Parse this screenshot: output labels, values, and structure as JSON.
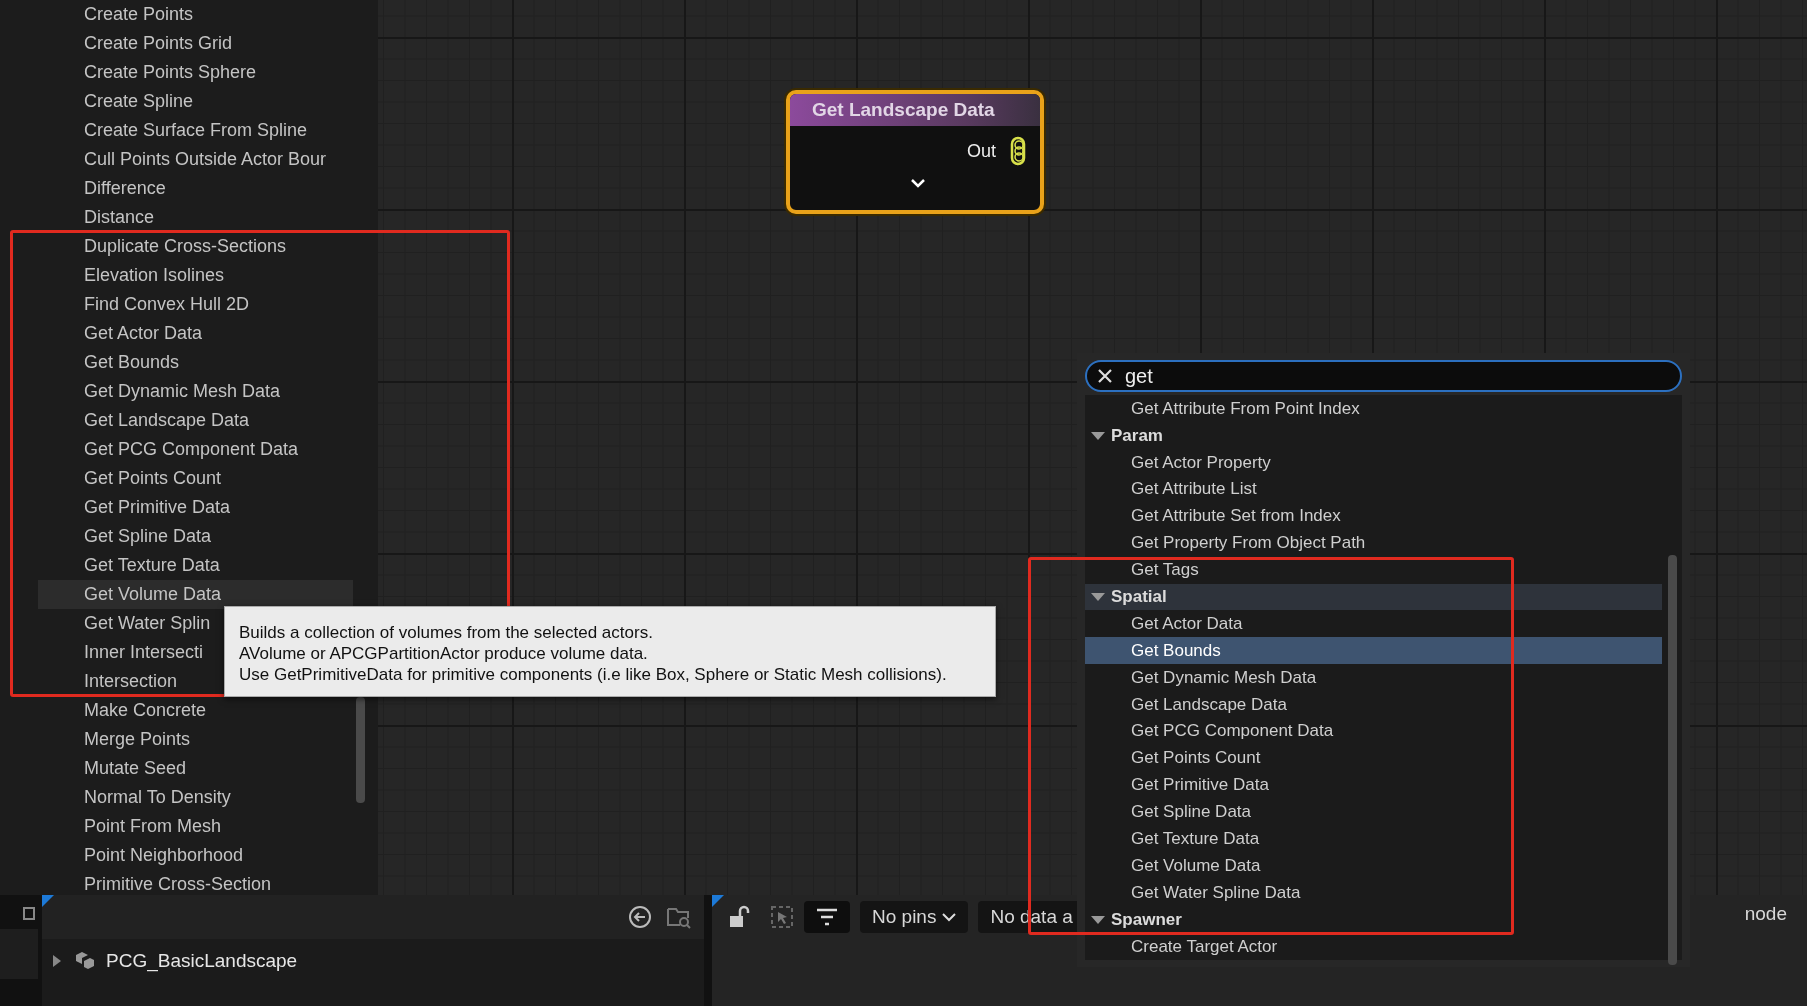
{
  "node_list": {
    "items": [
      {
        "label": "Create Points",
        "selected": false
      },
      {
        "label": "Create Points Grid",
        "selected": false
      },
      {
        "label": "Create Points Sphere",
        "selected": false
      },
      {
        "label": "Create Spline",
        "selected": false
      },
      {
        "label": "Create Surface From Spline",
        "selected": false
      },
      {
        "label": "Cull Points Outside Actor Bour",
        "selected": false
      },
      {
        "label": "Difference",
        "selected": false
      },
      {
        "label": "Distance",
        "selected": false
      },
      {
        "label": "Duplicate Cross-Sections",
        "selected": false
      },
      {
        "label": "Elevation Isolines",
        "selected": false
      },
      {
        "label": "Find Convex Hull 2D",
        "selected": false
      },
      {
        "label": "Get Actor Data",
        "selected": false
      },
      {
        "label": "Get Bounds",
        "selected": false
      },
      {
        "label": "Get Dynamic Mesh Data",
        "selected": false
      },
      {
        "label": "Get Landscape Data",
        "selected": false
      },
      {
        "label": "Get PCG Component Data",
        "selected": false
      },
      {
        "label": "Get Points Count",
        "selected": false
      },
      {
        "label": "Get Primitive Data",
        "selected": false
      },
      {
        "label": "Get Spline Data",
        "selected": false
      },
      {
        "label": "Get Texture Data",
        "selected": false
      },
      {
        "label": "Get Volume Data",
        "selected": true
      },
      {
        "label": "Get Water Splin",
        "selected": false
      },
      {
        "label": "Inner Intersecti",
        "selected": false
      },
      {
        "label": "Intersection",
        "selected": false
      },
      {
        "label": "Make Concrete",
        "selected": false
      },
      {
        "label": "Merge Points",
        "selected": false
      },
      {
        "label": "Mutate Seed",
        "selected": false
      },
      {
        "label": "Normal To Density",
        "selected": false
      },
      {
        "label": "Point From Mesh",
        "selected": false
      },
      {
        "label": "Point Neighborhood",
        "selected": false
      },
      {
        "label": "Primitive Cross-Section",
        "selected": false
      }
    ]
  },
  "tooltip": {
    "text": "Builds a collection of volumes from the selected actors.\nAVolume or APCGPartitionActor produce volume data.\nUse GetPrimitiveData for primitive components (i.e like Box, Sphere or Static Mesh collisions)."
  },
  "graph_node": {
    "title": "Get Landscape Data",
    "output_pin": "Out"
  },
  "search_menu": {
    "query": "get",
    "entries": [
      {
        "kind": "item",
        "label": "Get Attribute From Point Index",
        "selected": false
      },
      {
        "kind": "category",
        "label": "Param",
        "expanded": true,
        "hovered": false
      },
      {
        "kind": "item",
        "label": "Get Actor Property",
        "selected": false
      },
      {
        "kind": "item",
        "label": "Get Attribute List",
        "selected": false
      },
      {
        "kind": "item",
        "label": "Get Attribute Set from Index",
        "selected": false
      },
      {
        "kind": "item",
        "label": "Get Property From Object Path",
        "selected": false
      },
      {
        "kind": "item",
        "label": "Get Tags",
        "selected": false
      },
      {
        "kind": "category",
        "label": "Spatial",
        "expanded": true,
        "hovered": true
      },
      {
        "kind": "item",
        "label": "Get Actor Data",
        "selected": false
      },
      {
        "kind": "item",
        "label": "Get Bounds",
        "selected": true
      },
      {
        "kind": "item",
        "label": "Get Dynamic Mesh Data",
        "selected": false
      },
      {
        "kind": "item",
        "label": "Get Landscape Data",
        "selected": false
      },
      {
        "kind": "item",
        "label": "Get PCG Component Data",
        "selected": false
      },
      {
        "kind": "item",
        "label": "Get Points Count",
        "selected": false
      },
      {
        "kind": "item",
        "label": "Get Primitive Data",
        "selected": false
      },
      {
        "kind": "item",
        "label": "Get Spline Data",
        "selected": false
      },
      {
        "kind": "item",
        "label": "Get Texture Data",
        "selected": false
      },
      {
        "kind": "item",
        "label": "Get Volume Data",
        "selected": false
      },
      {
        "kind": "item",
        "label": "Get Water Spline Data",
        "selected": false
      },
      {
        "kind": "category",
        "label": "Spawner",
        "expanded": true,
        "hovered": false
      },
      {
        "kind": "item",
        "label": "Create Target Actor",
        "selected": false
      }
    ]
  },
  "outliner": {
    "items": [
      {
        "label": "PCG_BasicLandscape",
        "expanded": false
      }
    ]
  },
  "details_toolbar": {
    "dropdowns": [
      "No pins",
      "No data a"
    ],
    "trailing_text": "node"
  }
}
